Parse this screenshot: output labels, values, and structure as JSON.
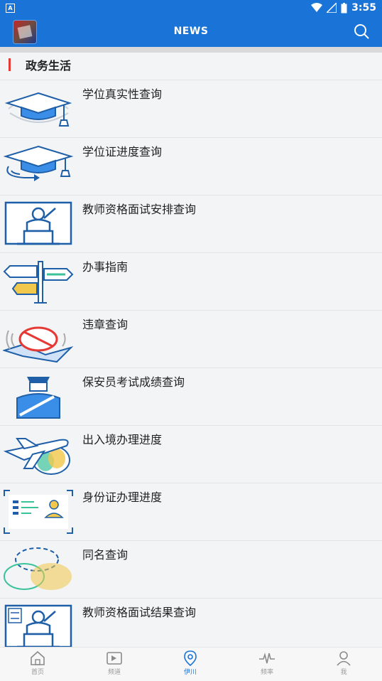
{
  "status_bar": {
    "time": "3:55",
    "app_indicator": "A"
  },
  "app_bar": {
    "title": "NEWS"
  },
  "section": {
    "title": "政务生活"
  },
  "items": [
    {
      "label": "学位真实性查询",
      "icon": "graduation-cap-icon"
    },
    {
      "label": "学位证进度查询",
      "icon": "graduation-cap-arrow-icon"
    },
    {
      "label": "教师资格面试安排查询",
      "icon": "teacher-podium-icon"
    },
    {
      "label": "办事指南",
      "icon": "signpost-icon"
    },
    {
      "label": "违章查询",
      "icon": "no-entry-icon"
    },
    {
      "label": "保安员考试成绩查询",
      "icon": "security-guard-icon"
    },
    {
      "label": "出入境办理进度",
      "icon": "airplane-globe-icon"
    },
    {
      "label": "身份证办理进度",
      "icon": "id-card-icon"
    },
    {
      "label": "同名查询",
      "icon": "overlapping-circles-icon"
    },
    {
      "label": "教师资格面试结果查询",
      "icon": "teacher-result-icon"
    }
  ],
  "bottom_nav": [
    {
      "label": "首页",
      "icon": "home-icon"
    },
    {
      "label": "频道",
      "icon": "channel-icon"
    },
    {
      "label": "伊川",
      "icon": "location-icon",
      "active": true
    },
    {
      "label": "频率",
      "icon": "pulse-icon"
    },
    {
      "label": "我",
      "icon": "user-icon"
    }
  ],
  "colors": {
    "primary": "#1a73d6",
    "accent": "#e53935",
    "icon_blue": "#1f5fa8"
  }
}
